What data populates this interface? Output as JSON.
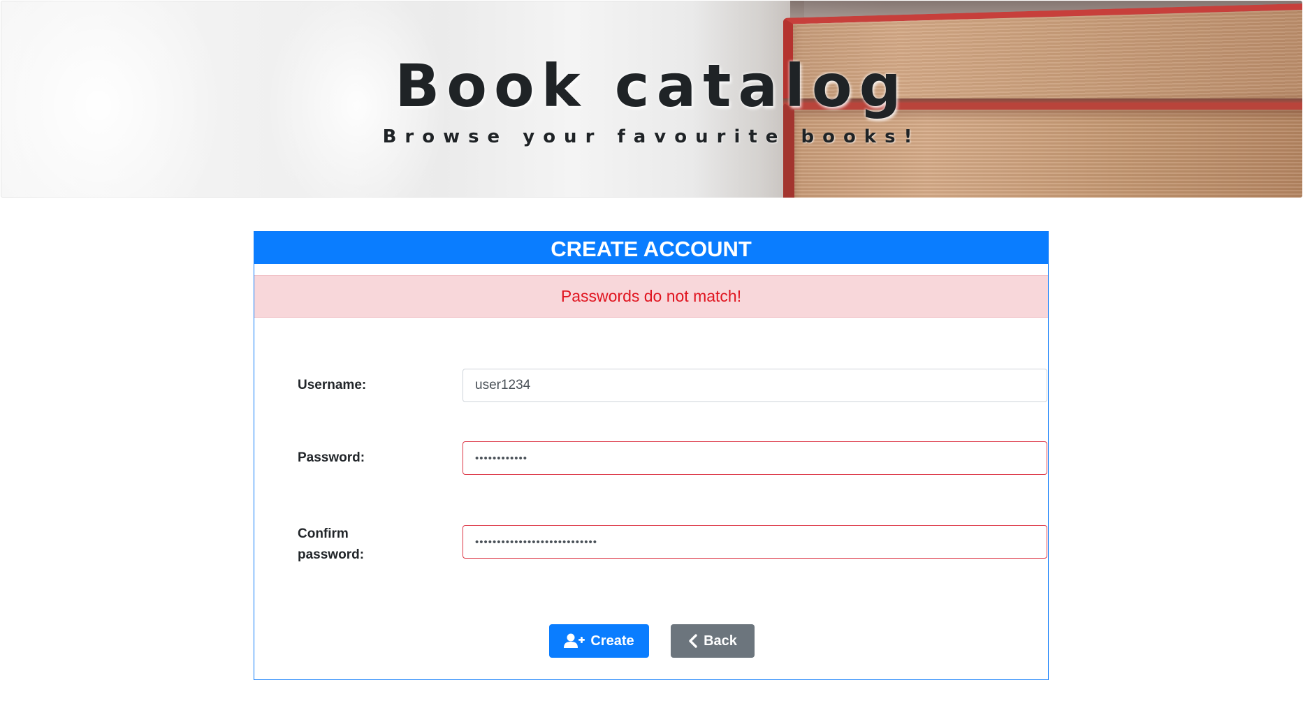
{
  "banner": {
    "title": "Book catalog",
    "subtitle": "Browse your favourite books!"
  },
  "card": {
    "title": "CREATE ACCOUNT",
    "alert": "Passwords do not match!",
    "fields": {
      "username": {
        "label": "Username:",
        "value": "user1234"
      },
      "password": {
        "label": "Password:",
        "value": "••••••••••••"
      },
      "confirm": {
        "label_line1": "Confirm",
        "label_line2": "password:",
        "value": "••••••••••••••••••••••••••••"
      }
    },
    "buttons": {
      "create": {
        "label": "Create",
        "icon": "user-plus-icon"
      },
      "back": {
        "label": "Back",
        "icon": "chevron-left-icon"
      }
    }
  },
  "colors": {
    "primary": "#0a7dff",
    "secondary": "#6c757d",
    "alert_bg": "#f8d7da",
    "alert_text": "#e0141f",
    "invalid_border": "#dc3545"
  }
}
